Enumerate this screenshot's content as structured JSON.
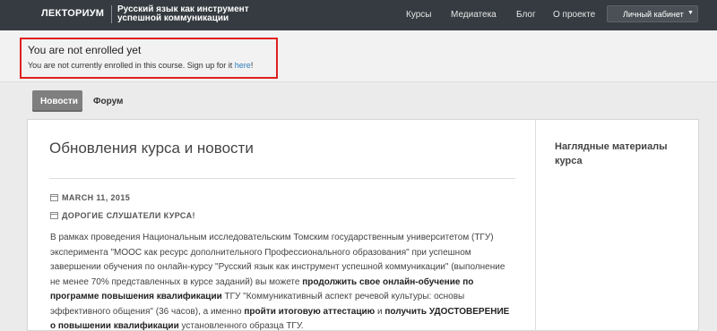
{
  "header": {
    "logo": "ЛЕКТОРИУМ",
    "course_title": "Русский язык как инструмент успешной коммуникации",
    "nav": [
      "Курсы",
      "Медиатека",
      "Блог",
      "О проекте"
    ],
    "cabinet_label": "Личный кабинет"
  },
  "notice": {
    "title": "You are not enrolled yet",
    "text_before": "You are not currently enrolled in this course. Sign up for it ",
    "link": "here",
    "text_after": "!"
  },
  "tabs": [
    "Новости",
    "Форум"
  ],
  "main": {
    "title": "Обновления курса и новости",
    "date": "MARCH 11, 2015",
    "subject": "ДОРОГИЕ СЛУШАТЕЛИ КУРСА!",
    "paragraph": {
      "p1": "В рамках проведения Национальным исследовательским Томским государственным университетом (ТГУ) эксперимента \"МООС как ресурс дополнительного Профессионального образования\" при успешном завершении обучения по онлайн-курсу \"Русский язык как инструмент успешной коммуникации\" (выполнение не  менее 70% представленных в курсе заданий) вы можете ",
      "b1": "продолжить свое онлайн-обучение по программе повышения квалификации",
      "p2": " ТГУ \"Коммуникативный аспект речевой культуры: основы эффективного общения\" (36  часов), а именно ",
      "b2": "пройти итоговую аттестацию",
      "p3": " и ",
      "b3": "получить  УДОСТОВЕРЕНИЕ о повышении квалификации",
      "p4": " установленного образца ТГУ."
    }
  },
  "sidebar": {
    "title": "Наглядные материалы курса"
  }
}
